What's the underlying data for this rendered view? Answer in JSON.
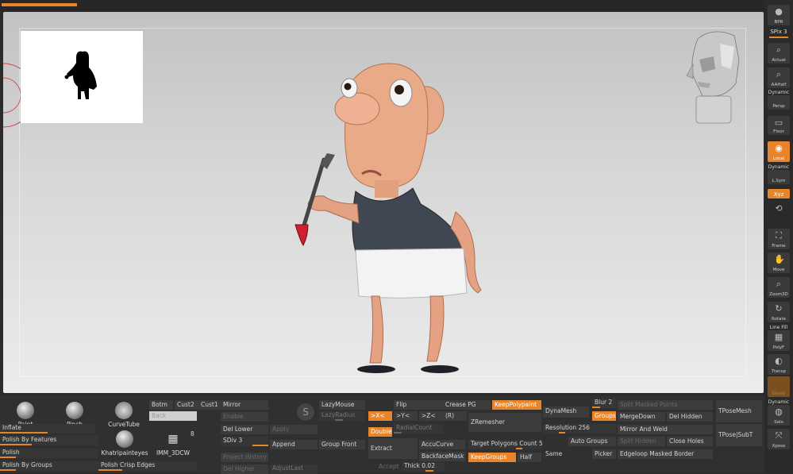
{
  "canvas": {
    "progress_fraction": 0.095
  },
  "right_shelf": {
    "bpr": "BPR",
    "spix": "SPix 3",
    "actual": "Actual",
    "aahalf": "AAHalf",
    "dynamic1": "Dynamic",
    "persp": "Persp",
    "floor": "Floor",
    "local": "Local",
    "dynamic2": "Dynamic",
    "lsym": "L.Sym",
    "xyz": "Xyz",
    "frame": "Frame",
    "move": "Move",
    "zoom3d": "Zoom3D",
    "rotate": "Rotate",
    "linefill": "Line Fill",
    "polyf": "PolyF",
    "transp": "Transp",
    "ghost": "Ghost",
    "dynamic3": "Dynamic",
    "solo": "Solo",
    "xpose": "Xpose"
  },
  "brushes": {
    "paint": "Paint",
    "pinch": "Pinch",
    "curvetube": "CurveTube",
    "khatri": "Khatripainteyes",
    "imm": "IMM_3DCW",
    "imm_count": "8"
  },
  "sliders_left": {
    "inflate": "Inflate",
    "polish_features": "Polish By Features",
    "polish": "Polish",
    "polish_groups": "Polish By Groups",
    "polish_crisp": "Polish Crisp Edges"
  },
  "subtool": {
    "botm": "Botm",
    "cust2": "Cust2",
    "cust1": "Cust1",
    "back": "Back",
    "mirror": "Mirror",
    "enable": "Enable",
    "del_lower": "Del Lower",
    "apply": "Apply",
    "sdiv": "SDiv 3",
    "append": "Append",
    "group_front": "Group Front",
    "project_history": "Project History",
    "del_higher": "Del Higher",
    "adjust_last": "AdjustLast"
  },
  "stroke": {
    "lazymouse": "LazyMouse",
    "lazyradius": "LazyRadius",
    "sym_x": ">X<",
    "sym_y": ">Y<",
    "sym_z": ">Z<",
    "sym_r": "(R)",
    "double": "Double",
    "radialcount": "RadialCount",
    "extract": "Extract",
    "accucurve": "AccuCurve",
    "backfacemask": "BackfaceMask",
    "accept": "Accept",
    "thick": "Thick 0.02"
  },
  "zremesher": {
    "flip": "Flip",
    "crease_pg": "Crease PG",
    "keep_polypaint": "KeepPolypaint",
    "zremesher": "ZRemesher",
    "target_count": "Target Polygons Count 5",
    "keep_groups": "KeepGroups",
    "half": "Half"
  },
  "dynamesh": {
    "dynamesh": "DynaMesh",
    "blur": "Blur 2",
    "groups": "Groups",
    "resolution": "Resolution 256",
    "same": "Same",
    "split_masked": "Split Masked Points",
    "merge_down": "MergeDown",
    "del_hidden": "Del Hidden",
    "mirror_weld": "Mirror And Weld",
    "auto_groups": "Auto Groups",
    "split_hidden": "Split Hidden",
    "close_holes": "Close Holes",
    "picker": "Picker",
    "edgeloop": "Edgeloop Masked Border",
    "tposemesh": "TPoseMesh",
    "tpose_subt": "TPose|SubT"
  }
}
